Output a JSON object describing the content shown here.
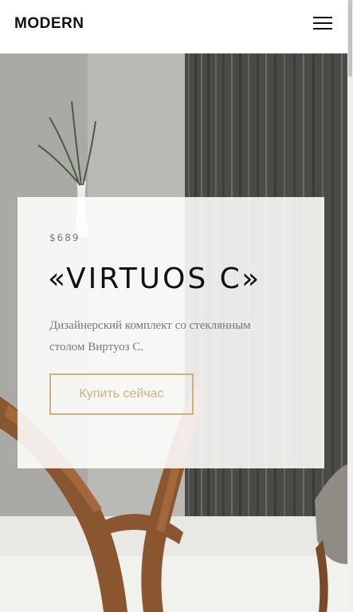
{
  "header": {
    "logo": "MODERN",
    "menu_icon": "hamburger-menu-icon"
  },
  "hero": {
    "price": "$689",
    "title": "«VIRTUOS C»",
    "description": "Дизайнерский комплект со стеклянным столом Виртуоз С.",
    "cta_label": "Купить сейчас"
  },
  "colors": {
    "accent": "#c9b37a",
    "text_dark": "#111111",
    "text_muted": "#777777"
  }
}
